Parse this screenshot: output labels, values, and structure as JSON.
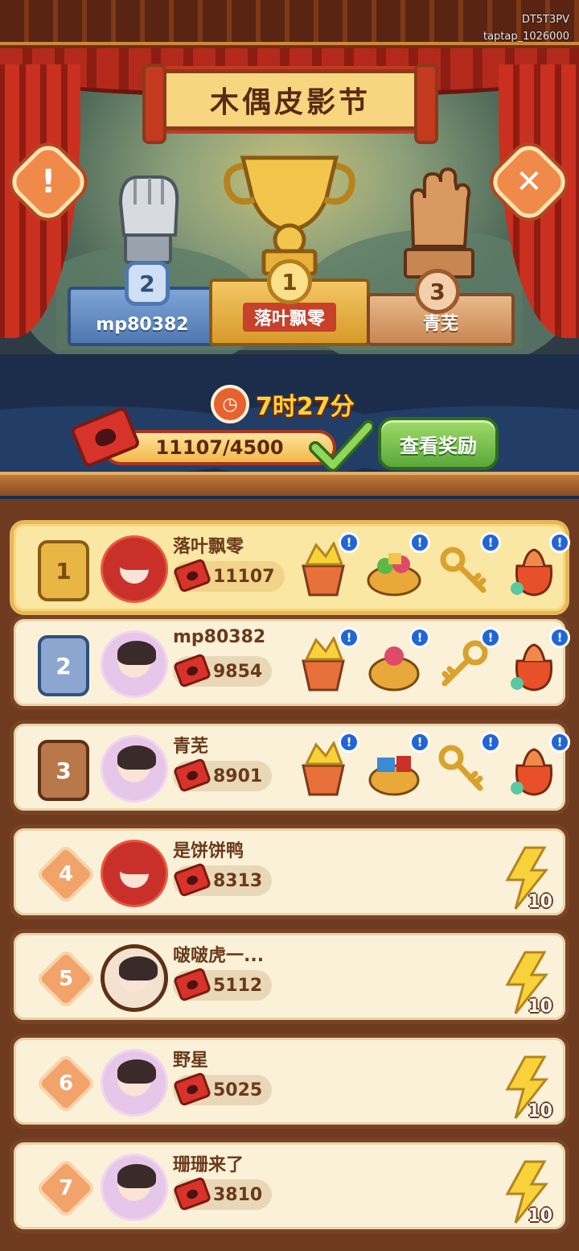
{
  "watermark": {
    "line1": "DT5T3PV",
    "line2": "taptap_1026000"
  },
  "header": {
    "title": "木偶皮影节",
    "info_icon": "exclamation-icon",
    "close_icon": "close-icon"
  },
  "podium": {
    "first": {
      "rank": "1",
      "name": "落叶飘零"
    },
    "second": {
      "rank": "2",
      "name": "mp80382"
    },
    "third": {
      "rank": "3",
      "name": "青芜"
    }
  },
  "timer": {
    "text": "7时27分",
    "icon": "clock-icon"
  },
  "progress": {
    "text": "11107/4500",
    "fraction": 1.0,
    "completed": true
  },
  "reward_button": {
    "label": "查看奖励"
  },
  "colors": {
    "accent_green": "#5aa83a",
    "ticket_red": "#d8332a",
    "gold": "#e7b645"
  },
  "rows": [
    {
      "rank": "1",
      "name": "落叶飘零",
      "score": "11107"
    },
    {
      "rank": "2",
      "name": "mp80382",
      "score": "9854"
    },
    {
      "rank": "3",
      "name": "青芜",
      "score": "8901"
    },
    {
      "rank": "4",
      "name": "是饼饼鸭",
      "score": "8313",
      "energy": "10"
    },
    {
      "rank": "5",
      "name": "啵啵虎一...",
      "score": "5112",
      "energy": "10"
    },
    {
      "rank": "6",
      "name": "野星",
      "score": "5025",
      "energy": "10"
    },
    {
      "rank": "7",
      "name": "珊珊来了",
      "score": "3810",
      "energy": "10"
    }
  ]
}
